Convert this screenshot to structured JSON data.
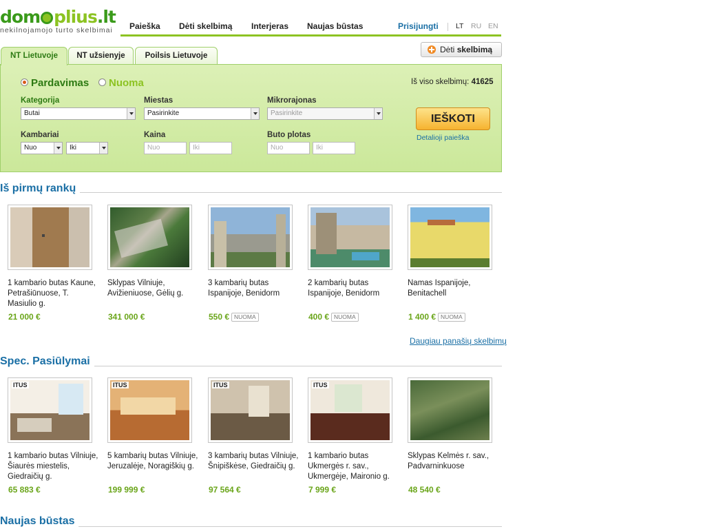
{
  "logo": {
    "part1": "dom",
    "part2": "plius",
    "tld": ".lt",
    "tagline": "nekilnojamojo turto skelbimai"
  },
  "nav": {
    "items": [
      "Paieška",
      "Dėti skelbimą",
      "Interjeras",
      "Naujas būstas"
    ],
    "login": "Prisijungti",
    "langs": [
      "LT",
      "RU",
      "EN"
    ]
  },
  "tabs": [
    "NT Lietuvoje",
    "NT užsienyje",
    "Poilsis Lietuvoje"
  ],
  "post_button": {
    "prefix": "Dėti",
    "bold": "skelbimą"
  },
  "search": {
    "radio_sale": "Pardavimas",
    "radio_rent": "Nuoma",
    "total_label": "Iš viso skelbimų:",
    "total_value": "41625",
    "category_label": "Kategorija",
    "category_value": "Butai",
    "city_label": "Miestas",
    "city_value": "Pasirinkite",
    "micro_label": "Mikrorajonas",
    "micro_value": "Pasirinkite",
    "rooms_label": "Kambariai",
    "rooms_from": "Nuo",
    "rooms_to": "Iki",
    "price_label": "Kaina",
    "price_from": "Nuo",
    "price_to": "Iki",
    "area_label": "Buto plotas",
    "area_from": "Nuo",
    "area_to": "Iki",
    "button": "IEŠKOTI",
    "advanced": "Detalioji paieška"
  },
  "section1": {
    "title": "Iš pirmų rankų",
    "more": "Daugiau panašių skelbimų",
    "cards": [
      {
        "title": "1 kambario butas Kaune, Petrašiūnuose, T. Masiulio g.",
        "price": "21 000 €",
        "badge": ""
      },
      {
        "title": "Sklypas Vilniuje, Avižieniuose, Gėlių g.",
        "price": "341 000 €",
        "badge": ""
      },
      {
        "title": "3 kambarių butas Ispanijoje, Benidorm",
        "price": "550 €",
        "badge": "NUOMA"
      },
      {
        "title": "2 kambarių butas Ispanijoje, Benidorm",
        "price": "400 €",
        "badge": "NUOMA"
      },
      {
        "title": "Namas Ispanijoje, Benitachell",
        "price": "1 400 €",
        "badge": "NUOMA"
      }
    ]
  },
  "section2": {
    "title": "Spec. Pasiūlymai",
    "brand": "ITUS",
    "cards": [
      {
        "title": "1 kambario butas Vilniuje, Šiaurės miestelis, Giedraičių g.",
        "price": "65 883 €"
      },
      {
        "title": "5 kambarių butas Vilniuje, Jeruzalėje, Noragiškių g.",
        "price": "199 999 €"
      },
      {
        "title": "3 kambarių butas Vilniuje, Šnipiškėse, Giedraičių g.",
        "price": "97 564 €"
      },
      {
        "title": "1 kambario butas Ukmergės r. sav., Ukmergėje, Maironio g.",
        "price": "7 999 €"
      },
      {
        "title": "Sklypas Kelmės r. sav., Padvarninkuose",
        "price": "48 540 €"
      }
    ]
  },
  "section3": {
    "title": "Naujas būstas"
  }
}
